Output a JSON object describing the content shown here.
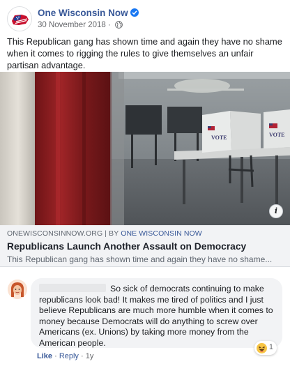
{
  "post": {
    "page_name": "One Wisconsin Now",
    "date": "30 November 2018",
    "meta_separator": "·",
    "text": "This Republican gang has shown time and again they have no shame when it comes to rigging the rules to give themselves an unfair partisan advantage."
  },
  "link": {
    "domain": "ONEWISCONSINNOW.ORG",
    "by_prefix": "| BY",
    "by_page": "ONE WISCONSIN NOW",
    "title": "Republicans Launch Another Assault on Democracy",
    "description": "This Republican gang has shown time and again they have no shame...",
    "image": {
      "booth_label": "VOTE"
    }
  },
  "comment": {
    "text": "So sick of democrats continuing to make republicans look bad! It makes me tired of politics and I just believe Republicans are much more humble when it comes to money because Democrats will do anything to screw over Americans (ex. Unions) by taking more money from the American people.",
    "reaction_count": "1",
    "like_label": "Like",
    "dot": "·",
    "reply_label": "Reply",
    "age": "1y"
  },
  "icons": {
    "verified": "verified-badge-icon",
    "globe": "globe-icon",
    "info": "i",
    "reaction": "haha-reaction-icon"
  },
  "colors": {
    "link_blue": "#385898",
    "verified_blue": "#1877f2",
    "secondary_text": "#65676b",
    "bubble_bg": "#f2f3f5"
  }
}
